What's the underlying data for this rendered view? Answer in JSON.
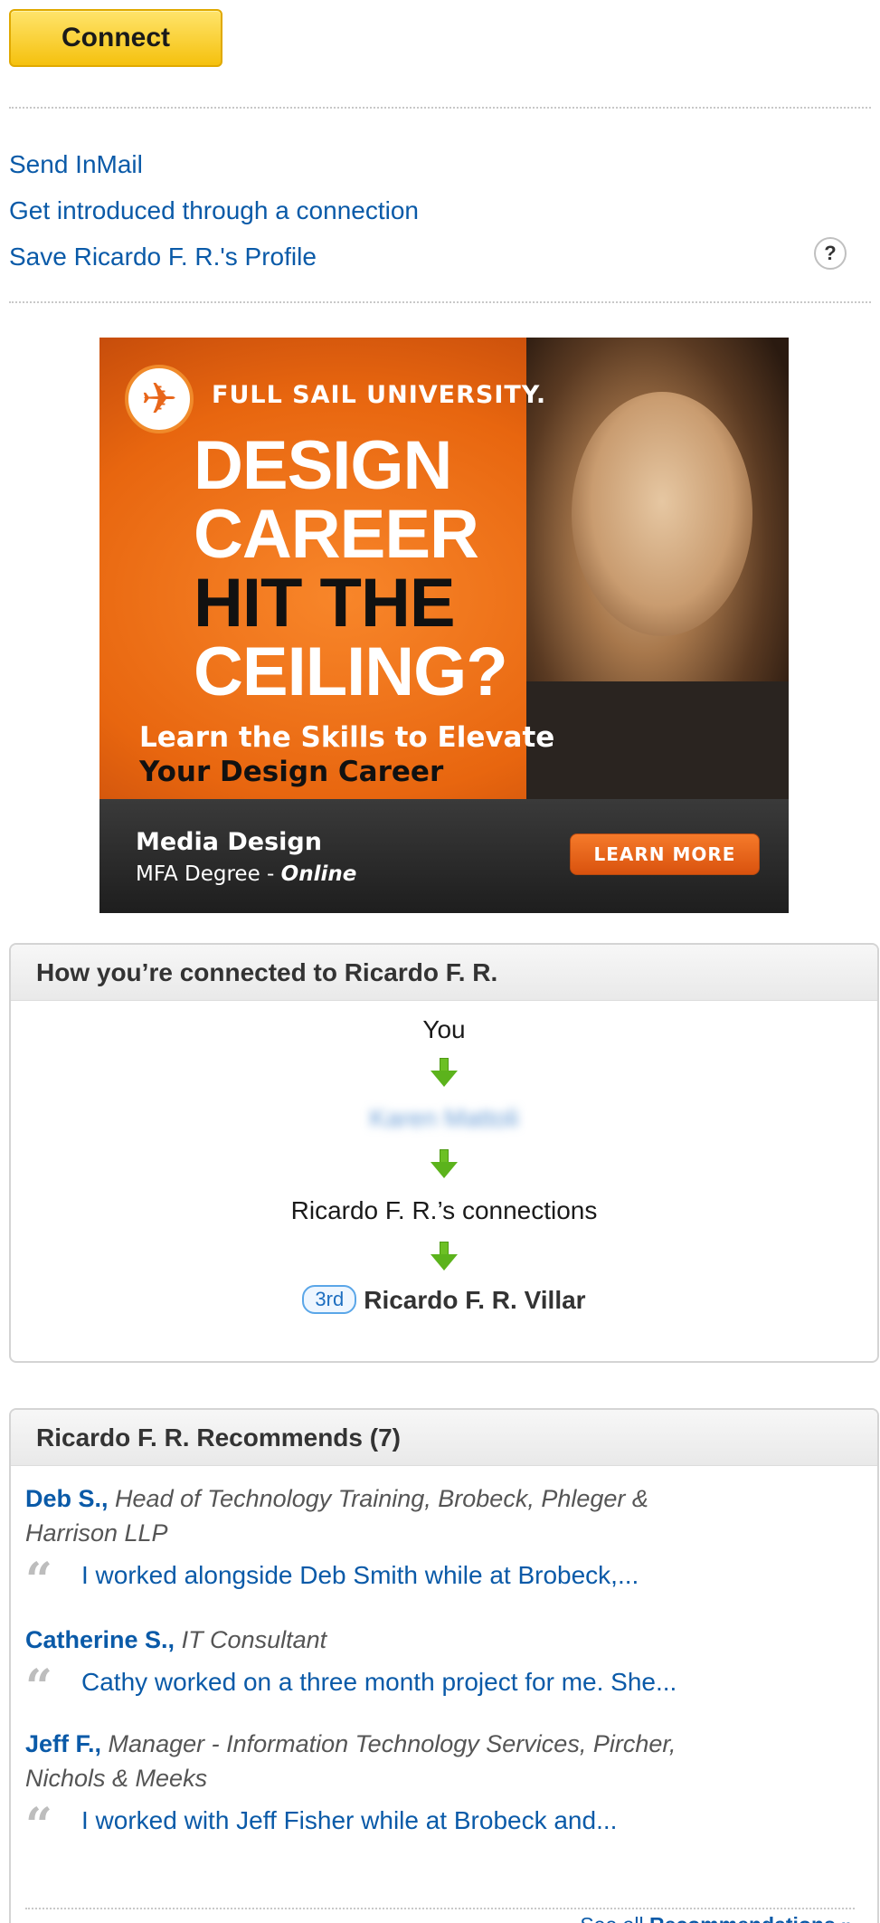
{
  "connect_button": "Connect",
  "actions": {
    "send_inmail": "Send InMail",
    "get_introduced": "Get introduced through a connection",
    "save_profile": "Save Ricardo F. R.'s Profile",
    "help": "?"
  },
  "ad": {
    "brand": "FULL SAIL UNIVERSITY.",
    "headline": [
      "DESIGN",
      "CAREER",
      "HIT THE",
      "CEILING?"
    ],
    "sub1": "Learn the Skills to Elevate",
    "sub2": "Your Design Career",
    "program": "Media Design",
    "degree_prefix": "MFA Degree - ",
    "degree_mode": "Online",
    "cta": "LEARN MORE"
  },
  "connections": {
    "title": "How you’re connected to Ricardo F. R.",
    "you": "You",
    "middle": "Karen Mattoli",
    "network": "Ricardo F. R.’s connections",
    "degree": "3rd",
    "target": "Ricardo F. R. Villar"
  },
  "recommendations": {
    "title": "Ricardo F. R. Recommends (7)",
    "items": [
      {
        "name": "Deb S.,",
        "title_line1": "Head of Technology Training, Brobeck, Phleger &",
        "title_line2": "Harrison LLP",
        "quote": "I worked alongside Deb Smith while at Brobeck,..."
      },
      {
        "name": "Catherine S.,",
        "title_line1": "IT Consultant",
        "title_line2": "",
        "quote": "Cathy worked on a three month project for me. She..."
      },
      {
        "name": "Jeff F.,",
        "title_line1": "Manager - Information Technology Services, Pircher,",
        "title_line2": "Nichols & Meeks",
        "quote": "I worked with Jeff Fisher while at Brobeck and..."
      }
    ],
    "see_all_prefix": "See all ",
    "see_all_bold": "Recommendations »"
  },
  "colors": {
    "link": "#0a5aa8",
    "connect_button": "#f5c10e",
    "ad_orange": "#e8660f",
    "arrow_green": "#6cc024"
  }
}
